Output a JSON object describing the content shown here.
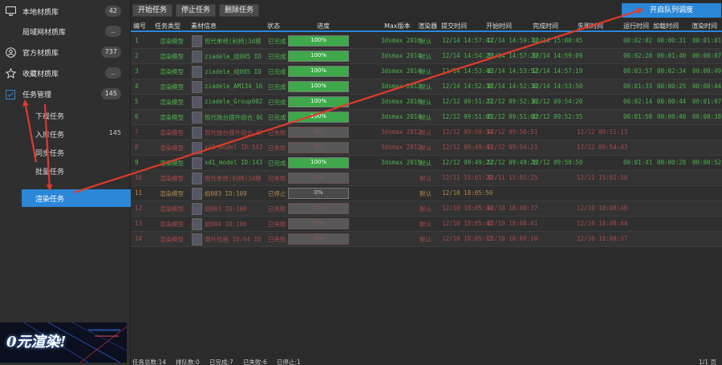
{
  "sidebar": {
    "items": [
      {
        "label": "本地材质库",
        "badge": "42",
        "icon": "monitor-icon"
      },
      {
        "label": "局域网材质库",
        "badge": "..",
        "icon": ""
      },
      {
        "label": "官方材质库",
        "badge": "737",
        "icon": "official-library-icon"
      },
      {
        "label": "收藏材质库",
        "badge": "..",
        "icon": "star-icon"
      },
      {
        "label": "任务管理",
        "badge": "145",
        "icon": "task-icon"
      }
    ],
    "sub_items": [
      {
        "label": "下载任务",
        "count": ""
      },
      {
        "label": "入库任务",
        "count": "145"
      },
      {
        "label": "同步任务",
        "count": ""
      },
      {
        "label": "批量任务",
        "count": ""
      },
      {
        "label": "渲染任务",
        "count": ""
      }
    ],
    "banner_text": "0元渲染!"
  },
  "toolbar": {
    "start": "开始任务",
    "stop": "停止任务",
    "delete": "删除任务",
    "queue": "开启队列调度"
  },
  "table": {
    "headers": [
      "编号",
      "任务类型",
      "素材信息",
      "状态",
      "进度",
      "Max版本",
      "渲染器",
      "提交时间",
      "开始时间",
      "完成时间",
      "失败时间",
      "运行时间",
      "加载时间",
      "渲染时间"
    ],
    "rows": [
      {
        "id": "1",
        "type": "渲染模型",
        "info": "现代单椅(利椅)3d模...",
        "status": "已完成",
        "progress": "100%",
        "pct": 100,
        "max": "3dsmax 2016",
        "renderer": "默认",
        "submit": "12/14 14:57:47",
        "start": "12/14 14:59:10",
        "finish": "12/14 15:00:45",
        "fail": "",
        "run": "00:02:02",
        "load": "00:00:31",
        "render": "00:01:01",
        "state": "done"
      },
      {
        "id": "2",
        "type": "渲染模型",
        "info": "ziadele_组005 ID:155",
        "status": "已完成",
        "progress": "100%",
        "pct": 100,
        "max": "3dsmax 2014",
        "renderer": "默认",
        "submit": "12/14 14:54:29",
        "start": "12/14 14:57:20",
        "finish": "12/14 14:59:09",
        "fail": "",
        "run": "00:02:20",
        "load": "00:01:40",
        "render": "00:00:07",
        "state": "done"
      },
      {
        "id": "3",
        "type": "渲染模型",
        "info": "ziadele_组005 ID:155",
        "status": "已完成",
        "progress": "100%",
        "pct": 100,
        "max": "3dsmax 2014",
        "renderer": "默认",
        "submit": "12/14 14:53:46",
        "start": "12/14 14:53:52",
        "finish": "12/14 14:57:19",
        "fail": "",
        "run": "00:03:57",
        "load": "00:02:34",
        "render": "00:00:49",
        "state": "done"
      },
      {
        "id": "4",
        "type": "渲染模型",
        "info": "ziadele_AM134_16_k...",
        "status": "已完成",
        "progress": "100%",
        "pct": 100,
        "max": "3dsmax 2013",
        "renderer": "默认",
        "submit": "12/14 14:52:38",
        "start": "12/14 14:52:38",
        "finish": "12/14 14:53:50",
        "fail": "",
        "run": "00:01:33",
        "load": "00:00:25",
        "render": "00:00:44",
        "state": "done"
      },
      {
        "id": "5",
        "type": "渲染模型",
        "info": "ziadele_Group002 ID...",
        "status": "已完成",
        "progress": "100%",
        "pct": 100,
        "max": "3dsmax 2016",
        "renderer": "默认",
        "submit": "12/12 09:51:21",
        "start": "12/12 09:52:36",
        "finish": "12/12 09:54:20",
        "fail": "",
        "run": "00:02:14",
        "load": "00:00:44",
        "render": "00:01:07",
        "state": "done"
      },
      {
        "id": "6",
        "type": "渲染模型",
        "info": "现代独台摆件组合_00...",
        "status": "已完成",
        "progress": "100%",
        "pct": 100,
        "max": "3dsmax 2014",
        "renderer": "默认",
        "submit": "12/12 09:51:05",
        "start": "12/12 09:51:00",
        "finish": "12/12 09:52:35",
        "fail": "",
        "run": "00:01:58",
        "load": "00:00:40",
        "render": "00:00:38",
        "state": "done"
      },
      {
        "id": "7",
        "type": "渲染模型",
        "info": "现代独台摆件组合_00...",
        "status": "已失败",
        "progress": "0%",
        "pct": 0,
        "max": "3dsmax 2012",
        "renderer": "默认",
        "submit": "12/12 09:50:34",
        "start": "12/12 09:50:51",
        "finish": "",
        "fail": "12/12 09:51:13",
        "run": "",
        "load": "",
        "render": "",
        "state": "fail"
      },
      {
        "id": "8",
        "type": "渲染模型",
        "info": "xd1_model ID:143",
        "status": "已失败",
        "progress": "0%",
        "pct": 0,
        "max": "3dsmax 2012",
        "renderer": "默认",
        "submit": "12/12 09:49:41",
        "start": "12/12 09:54:21",
        "finish": "",
        "fail": "12/12 09:54:43",
        "run": "",
        "load": "",
        "render": "",
        "state": "fail"
      },
      {
        "id": "9",
        "type": "渲染模型",
        "info": "xd1_model ID:143",
        "status": "已完成",
        "progress": "100%",
        "pct": 100,
        "max": "3dsmax 2015",
        "renderer": "默认",
        "submit": "12/12 09:49:27",
        "start": "12/12 09:49:28",
        "finish": "12/12 09:50:50",
        "fail": "",
        "run": "00:01:41",
        "load": "00:00:28",
        "render": "00:00:52",
        "state": "done"
      },
      {
        "id": "10",
        "type": "渲染模型",
        "info": "现代单椅(利椅)3d模...",
        "status": "已失败",
        "progress": "0%",
        "pct": 0,
        "max": "",
        "renderer": "默认",
        "submit": "12/11 15:01:20",
        "start": "12/11 15:01:25",
        "finish": "",
        "fail": "12/11 15:01:58",
        "run": "",
        "load": "",
        "render": "",
        "state": "fail"
      },
      {
        "id": "11",
        "type": "渲染模型",
        "info": "组003 ID:109",
        "status": "已停止",
        "progress": "0%",
        "pct": 0,
        "max": "",
        "renderer": "默认",
        "submit": "12/10 18:05:50",
        "start": "",
        "finish": "",
        "fail": "",
        "run": "",
        "load": "",
        "render": "",
        "state": "stop"
      },
      {
        "id": "12",
        "type": "渲染模型",
        "info": "组003 ID:109",
        "status": "已失败",
        "progress": "0%",
        "pct": 0,
        "max": "",
        "renderer": "默认",
        "submit": "12/10 18:05:44",
        "start": "12/10 18:08:37",
        "finish": "",
        "fail": "12/10 18:08:40",
        "run": "",
        "load": "",
        "render": "",
        "state": "fail"
      },
      {
        "id": "13",
        "type": "渲染模型",
        "info": "组004 ID:106",
        "status": "已失败",
        "progress": "0%",
        "pct": 0,
        "max": "",
        "renderer": "默认",
        "submit": "12/10 18:05:40",
        "start": "12/10 18:08:41",
        "finish": "",
        "fail": "12/10 18:08:44",
        "run": "",
        "load": "",
        "render": "",
        "state": "fail"
      },
      {
        "id": "14",
        "type": "渲染模型",
        "info": "簿叶挂画 ID:64 ID...",
        "status": "已失败",
        "progress": "0%",
        "pct": 0,
        "max": "",
        "renderer": "默认",
        "submit": "12/10 18:05:13",
        "start": "12/10 18:09:10",
        "finish": "",
        "fail": "12/10 18:09:37",
        "run": "",
        "load": "",
        "render": "",
        "state": "fail"
      }
    ]
  },
  "status": {
    "total": "任务总数:14",
    "queued": "排队数:0",
    "done": "已完成:7",
    "failed": "已失败:6",
    "stopped": "已停止:1",
    "page": "1/1 页"
  },
  "colors": {
    "accent": "#2b87d8",
    "done": "#4db34d",
    "fail": "#a84a4a",
    "arrow": "#e03a2a"
  }
}
